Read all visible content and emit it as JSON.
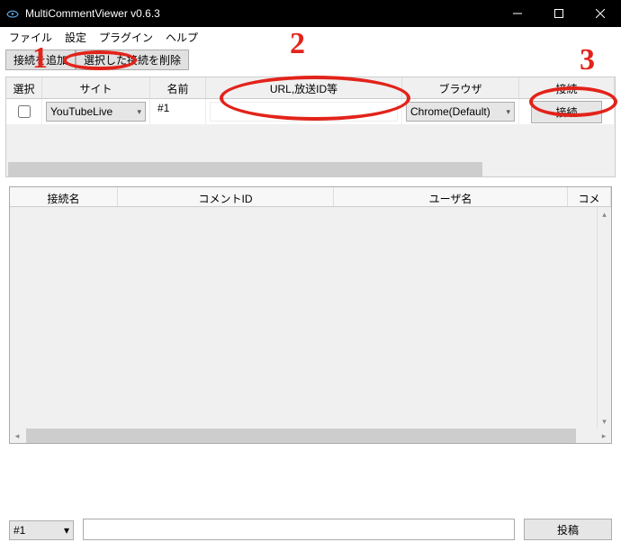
{
  "title": "MultiCommentViewer v0.6.3",
  "menu": {
    "file": "ファイル",
    "settings": "設定",
    "plugins": "プラグイン",
    "help": "ヘルプ"
  },
  "toolbar": {
    "add_connection": "接続を追加",
    "remove_selected": "選択した接続を削除"
  },
  "top_grid": {
    "headers": {
      "select": "選択",
      "site": "サイト",
      "name": "名前",
      "url": "URL,放送ID等",
      "browser": "ブラウザ",
      "connect": "接続"
    },
    "row": {
      "site_selected": "YouTubeLive",
      "name": "#1",
      "url": "",
      "browser_selected": "Chrome(Default)",
      "connect_label": "接続"
    }
  },
  "bottom_grid": {
    "headers": {
      "conn_name": "接続名",
      "comment_id": "コメントID",
      "user_name": "ユーザ名",
      "comment": "コメント"
    }
  },
  "footer": {
    "channel": "#1",
    "post_label": "投稿"
  },
  "annotations": {
    "n1": "1",
    "n2": "2",
    "n3": "3"
  }
}
